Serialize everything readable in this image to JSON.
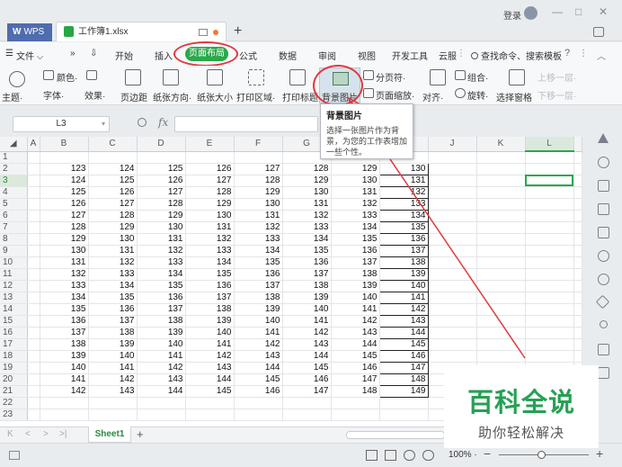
{
  "titlebar": {
    "app_tab": "WPS",
    "app_tab_logo": "W",
    "file_tab": "工作簿1.xlsx",
    "new_tab": "+",
    "login": "登录",
    "minimize": "—",
    "maximize": "□",
    "close": "✕"
  },
  "menu": {
    "file": "文件",
    "file_arrow": "⌵",
    "more": "»",
    "more2": "⇩",
    "tabs": [
      "开始",
      "插入",
      "页面布局",
      "公式",
      "数据",
      "审阅",
      "视图",
      "开发工具",
      "云服"
    ],
    "search": "查找命令、搜索模板",
    "help": "?",
    "share_marker": "⋮",
    "collapse": "︿"
  },
  "ribbon": {
    "theme": "主题·",
    "colors": "颜色·",
    "fonts": "字体·",
    "effects": "效果·",
    "margins": "页边距",
    "orientation": "纸张方向·",
    "size": "纸张大小",
    "print_area": "打印区域·",
    "print_titles": "打印标题",
    "background_image": "背景图片",
    "page_break": "分页符·",
    "page_zoom": "页面缩放·",
    "align": "对齐·",
    "group": "组合·",
    "rotate": "旋转·",
    "selection_pane": "选择窗格",
    "bring_forward": "上移一层·",
    "send_backward": "下移一层·"
  },
  "tooltip": {
    "title": "背景图片",
    "description": "选择一张图片作为背景，为您的工作表增加一些个性。"
  },
  "formula": {
    "name_box": "L3",
    "fx": "fx"
  },
  "grid": {
    "columns": [
      "A",
      "B",
      "C",
      "D",
      "E",
      "F",
      "G",
      "H",
      "I",
      "J",
      "K",
      "L"
    ],
    "active_column": "L",
    "active_row": 3,
    "row_labels": [
      "1",
      "2",
      "3",
      "4",
      "5",
      "6",
      "7",
      "8",
      "9",
      "10",
      "11",
      "12",
      "13",
      "14",
      "15",
      "16",
      "17",
      "18",
      "19",
      "20",
      "21",
      "22",
      "23"
    ],
    "rows": [
      [],
      [
        123,
        124,
        125,
        126,
        127,
        128,
        129,
        130
      ],
      [
        124,
        125,
        126,
        127,
        128,
        129,
        130,
        131
      ],
      [
        125,
        126,
        127,
        128,
        129,
        130,
        131,
        132
      ],
      [
        126,
        127,
        128,
        129,
        130,
        131,
        132,
        133
      ],
      [
        127,
        128,
        129,
        130,
        131,
        132,
        133,
        134
      ],
      [
        128,
        129,
        130,
        131,
        132,
        133,
        134,
        135
      ],
      [
        129,
        130,
        131,
        132,
        133,
        134,
        135,
        136
      ],
      [
        130,
        131,
        132,
        133,
        134,
        135,
        136,
        137
      ],
      [
        131,
        132,
        133,
        134,
        135,
        136,
        137,
        138
      ],
      [
        132,
        133,
        134,
        135,
        136,
        137,
        138,
        139
      ],
      [
        133,
        134,
        135,
        136,
        137,
        138,
        139,
        140
      ],
      [
        134,
        135,
        136,
        137,
        138,
        139,
        140,
        141
      ],
      [
        135,
        136,
        137,
        138,
        139,
        140,
        141,
        142
      ],
      [
        136,
        137,
        138,
        139,
        140,
        141,
        142,
        143
      ],
      [
        137,
        138,
        139,
        140,
        141,
        142,
        143,
        144
      ],
      [
        138,
        139,
        140,
        141,
        142,
        143,
        144,
        145
      ],
      [
        139,
        140,
        141,
        142,
        143,
        144,
        145,
        146
      ],
      [
        140,
        141,
        142,
        143,
        144,
        145,
        146,
        147
      ],
      [
        141,
        142,
        143,
        144,
        145,
        146,
        147,
        148
      ],
      [
        142,
        143,
        144,
        145,
        146,
        147,
        148,
        149
      ],
      [],
      []
    ]
  },
  "sheets": {
    "active": "Sheet1",
    "add": "+",
    "nav": [
      "K",
      "<",
      ">",
      ">|"
    ]
  },
  "status": {
    "zoom": "100%",
    "zoom_dropdown": "·",
    "minus": "−",
    "plus": "+"
  },
  "watermark": {
    "title": "百科全说",
    "subtitle": "助你轻松解决"
  },
  "colors": {
    "accent_green": "#2aa84a",
    "annotation_red": "#e0393e",
    "wps_blue": "#4f6cae"
  }
}
